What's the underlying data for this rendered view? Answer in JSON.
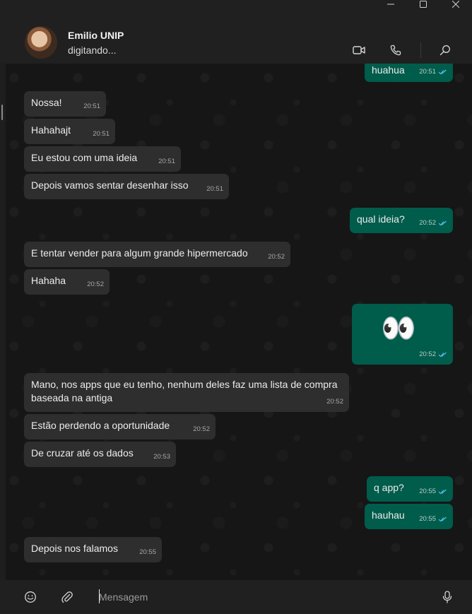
{
  "window": {
    "minimize_icon": "minimize-icon",
    "maximize_icon": "maximize-icon",
    "close_icon": "close-icon"
  },
  "header": {
    "contact_name": "Emilio UNIP",
    "status": "digitando...",
    "icons": [
      "video-call-icon",
      "voice-call-icon",
      "search-icon"
    ]
  },
  "messages": [
    {
      "dir": "out",
      "text": "huahua",
      "time": "20:51",
      "read": true
    },
    {
      "dir": "in",
      "text": "Nossa!",
      "time": "20:51"
    },
    {
      "dir": "in",
      "text": "Hahahajt",
      "time": "20:51"
    },
    {
      "dir": "in",
      "text": "Eu estou com uma ideia",
      "time": "20:51"
    },
    {
      "dir": "in",
      "text": "Depois vamos sentar desenhar isso",
      "time": "20:51"
    },
    {
      "dir": "out",
      "text": "qual ideia?",
      "time": "20:52",
      "read": true
    },
    {
      "dir": "in",
      "text": "E tentar vender para algum grande hipermercado",
      "time": "20:52"
    },
    {
      "dir": "in",
      "text": "Hahaha",
      "time": "20:52"
    },
    {
      "dir": "out",
      "text": "👀",
      "time": "20:52",
      "read": true
    },
    {
      "dir": "in",
      "text": "Mano, nos apps que eu tenho, nenhum deles faz uma lista de compra",
      "text2": "baseada na antiga",
      "time": "20:52"
    },
    {
      "dir": "in",
      "text": "Estão perdendo a oportunidade",
      "time": "20:52"
    },
    {
      "dir": "in",
      "text": "De cruzar até os dados",
      "time": "20:53"
    },
    {
      "dir": "out",
      "text": "q app?",
      "time": "20:55",
      "read": true
    },
    {
      "dir": "out",
      "text": "hauhau",
      "time": "20:55",
      "read": true
    },
    {
      "dir": "in",
      "text": "Depois nos falamos",
      "time": "20:55"
    }
  ],
  "composer": {
    "placeholder": "Mensagem",
    "icons": [
      "emoji-icon",
      "attach-icon",
      "microphone-icon"
    ]
  },
  "colors": {
    "incoming_bubble": "#2e2e2e",
    "outgoing_bubble": "#005c4b",
    "read_ticks": "#53bdeb",
    "chat_background": "#161616"
  }
}
